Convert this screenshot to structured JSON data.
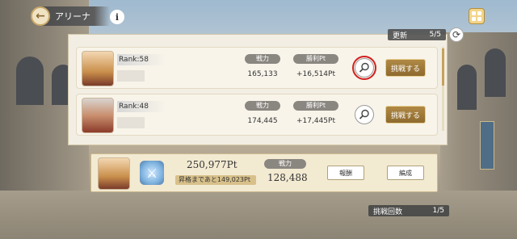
{
  "header": {
    "title": "アリーナ",
    "back_icon": "arrow-left-icon",
    "info_icon": "info-icon",
    "menu_icon": "grid-menu-icon"
  },
  "update": {
    "label": "更新",
    "count": "5/5"
  },
  "opponents": [
    {
      "rank": "Rank:58",
      "power_label": "戦力",
      "power": "165,133",
      "reward_label": "勝利Pt",
      "reward": "+16,514Pt",
      "challenge_label": "挑戦する",
      "highlighted": true
    },
    {
      "rank": "Rank:48",
      "power_label": "戦力",
      "power": "174,445",
      "reward_label": "勝利Pt",
      "reward": "+17,445Pt",
      "challenge_label": "挑戦する",
      "highlighted": false
    }
  ],
  "player": {
    "score": "250,977Pt",
    "promotion": "昇格まであと149,023Pt",
    "power_label": "戦力",
    "power": "128,488",
    "reward_button": "報酬",
    "formation_button": "編成"
  },
  "challenge_count": {
    "label": "挑戦回数",
    "value": "1/5"
  },
  "colors": {
    "accent_gold": "#b08945",
    "highlight_red": "#d21f1f"
  }
}
